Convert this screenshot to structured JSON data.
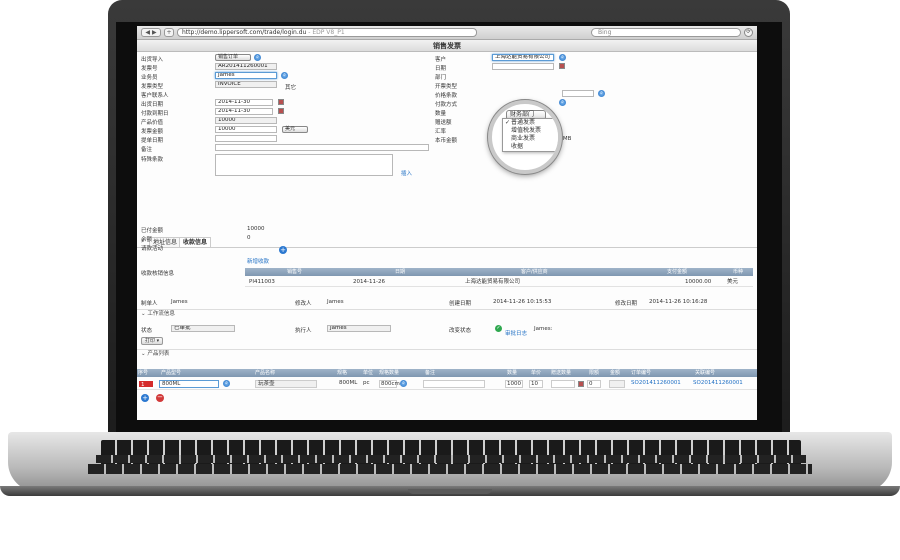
{
  "browser": {
    "url": "http://demo.lippersoft.com/trade/login.du",
    "url_suffix": "- EDP V8_P1",
    "search_placeholder": "Bing",
    "nav_back": "◀ ▶",
    "nav_add": "+"
  },
  "page_title": "销售发票",
  "form": {
    "source_import_label": "出货导入",
    "source_import_value": "销售订单",
    "invoice_no_label": "发票号",
    "invoice_no_value": "AR201411260001",
    "salesperson_label": "业务员",
    "salesperson_value": "James",
    "invoice_type_label": "发票类型",
    "invoice_type_value": "INVOICE",
    "invoice_type_note": "其它",
    "customer_contact_label": "客户联系人",
    "ship_date_label": "出货日期",
    "ship_date_value": "2014-11-30",
    "pay_due_label": "付款到期日",
    "pay_due_value": "2014-11-30",
    "product_value_label": "产品价值",
    "product_value_value": "10000",
    "invoice_amount_label": "发票金额",
    "invoice_amount_value": "10000",
    "currency_value": "美元",
    "bill_date_label": "提单日期",
    "remark_label": "备注",
    "special_terms_label": "特殊条款",
    "insert_label": "插入",
    "customer_label": "客户",
    "customer_value": "上海达能贸易有限公司",
    "date_label": "日期",
    "department_label": "部门",
    "department_value": "财务部门",
    "invoice_kind_label": "开票类型",
    "price_terms_label": "价格条款",
    "pay_method_label": "付款方式",
    "quantity_label": "数量",
    "gift_label": "赠送额",
    "exchange_rate_label": "汇率",
    "local_amount_label": "本币金额",
    "local_amount_value": "65000",
    "local_currency": "RMB"
  },
  "invoice_kind_dropdown": {
    "selected": "财务部门",
    "options": [
      "普通发票",
      "增值税发票",
      "商业发票",
      "收据"
    ]
  },
  "tabs": [
    {
      "label": "地址信息"
    },
    {
      "label": "收款信息"
    }
  ],
  "receipt": {
    "paid_label": "已付金额",
    "paid_value": "10000",
    "balance_label": "余额",
    "balance_value": "0",
    "activity_label": "请款活动",
    "new_receipt_label": "新增收款",
    "detail_label": "收款核销信息",
    "columns": [
      "销售号",
      "日期",
      "客户/供应商",
      "支付金额",
      "币种"
    ],
    "rows": [
      {
        "no": "PI411003",
        "date": "2014-11-26",
        "customer": "上海达能贸易有限公司",
        "amount": "10000.00",
        "currency": "美元"
      }
    ]
  },
  "audit": {
    "creator_label": "制单人",
    "creator_value": "James",
    "modifier_label": "修改人",
    "modifier_value": "James",
    "created_date_label": "创建日期",
    "created_date_value": "2014-11-26 10:15:53",
    "modified_date_label": "修改日期",
    "modified_date_value": "2014-11-26 10:16:28"
  },
  "workflow": {
    "section_label": "工作流信息",
    "status_label": "状态",
    "status_value": "已审批",
    "executor_label": "执行人",
    "executor_value": "James",
    "change_status_label": "改变状态",
    "audit_log_label": "审批日志",
    "audit_user": "James:",
    "print_label": "打印"
  },
  "products": {
    "section_label": "产品列表",
    "columns": [
      "序号",
      "产品型号",
      "产品名称",
      "规格",
      "单位",
      "规格数量",
      "备注",
      "数量",
      "单价",
      "赠送数量",
      "限额",
      "金额",
      "订单编号",
      "关联编号"
    ],
    "rows": [
      {
        "seq": "1",
        "model": "800ML",
        "name": "玩茶壶",
        "spec": "800ML",
        "unit": "pc",
        "spec_qty": "800cm",
        "remark": "",
        "qty": "1000",
        "price": "10",
        "gift": "0",
        "limit": "",
        "amount": "",
        "order_no": "SO201411260001",
        "ref_no": "SO201411260001"
      }
    ]
  }
}
